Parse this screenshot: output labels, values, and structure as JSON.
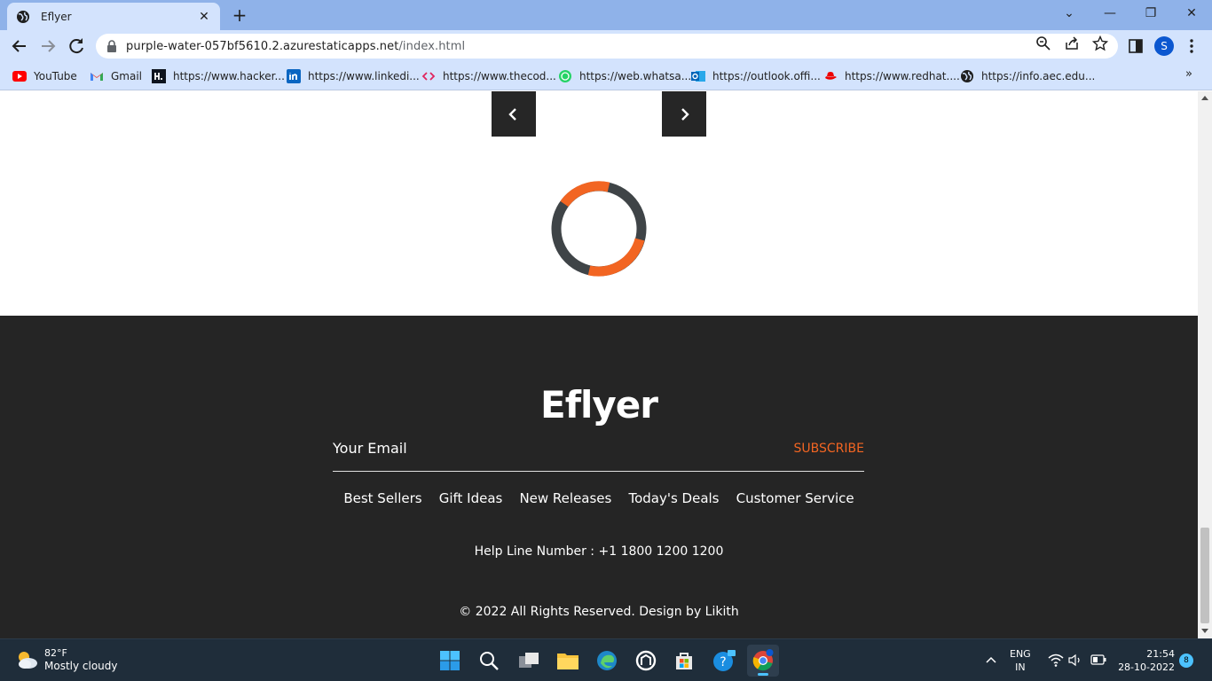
{
  "browser": {
    "tab_title": "Eflyer",
    "tab_close_glyph": "✕",
    "new_tab_glyph": "+",
    "window_controls": [
      "⌄",
      "—",
      "❐",
      "✕"
    ],
    "url_host": "purple-water-057bf5610.2.azurestaticapps.net",
    "url_path": "/index.html",
    "profile_initial": "S",
    "bookmarks": [
      {
        "label": "YouTube",
        "icon": "youtube-icon"
      },
      {
        "label": "Gmail",
        "icon": "gmail-icon"
      },
      {
        "label": "https://www.hacker...",
        "icon": "hackerrank-icon"
      },
      {
        "label": "https://www.linkedi...",
        "icon": "linkedin-icon"
      },
      {
        "label": "https://www.thecod...",
        "icon": "code-icon"
      },
      {
        "label": "https://web.whatsa...",
        "icon": "whatsapp-icon"
      },
      {
        "label": "https://outlook.offi...",
        "icon": "outlook-icon"
      },
      {
        "label": "https://www.redhat....",
        "icon": "redhat-icon"
      },
      {
        "label": "https://info.aec.edu...",
        "icon": "globe-icon"
      }
    ],
    "bookmarks_more_glyph": "»"
  },
  "colors": {
    "accent": "#f26522",
    "footer_bg": "#252525",
    "loader_dark": "#3f4447",
    "chrome_tab": "#d3e3fd"
  },
  "slider": {
    "prev_icon": "chevron-left-icon",
    "next_icon": "chevron-right-icon"
  },
  "footer": {
    "logo": "Eflyer",
    "email_placeholder": "Your Email",
    "subscribe_label": "SUBSCRIBE",
    "nav": [
      "Best Sellers",
      "Gift Ideas",
      "New Releases",
      "Today's Deals",
      "Customer Service"
    ],
    "helpline": "Help Line Number : +1 1800 1200 1200",
    "copyright": "© 2022 All Rights Reserved. Design by Likith"
  },
  "taskbar": {
    "temperature": "82°F",
    "weather": "Mostly cloudy",
    "lang": "ENG",
    "region": "IN",
    "time": "21:54",
    "date": "28-10-2022",
    "notification_count": "8"
  }
}
